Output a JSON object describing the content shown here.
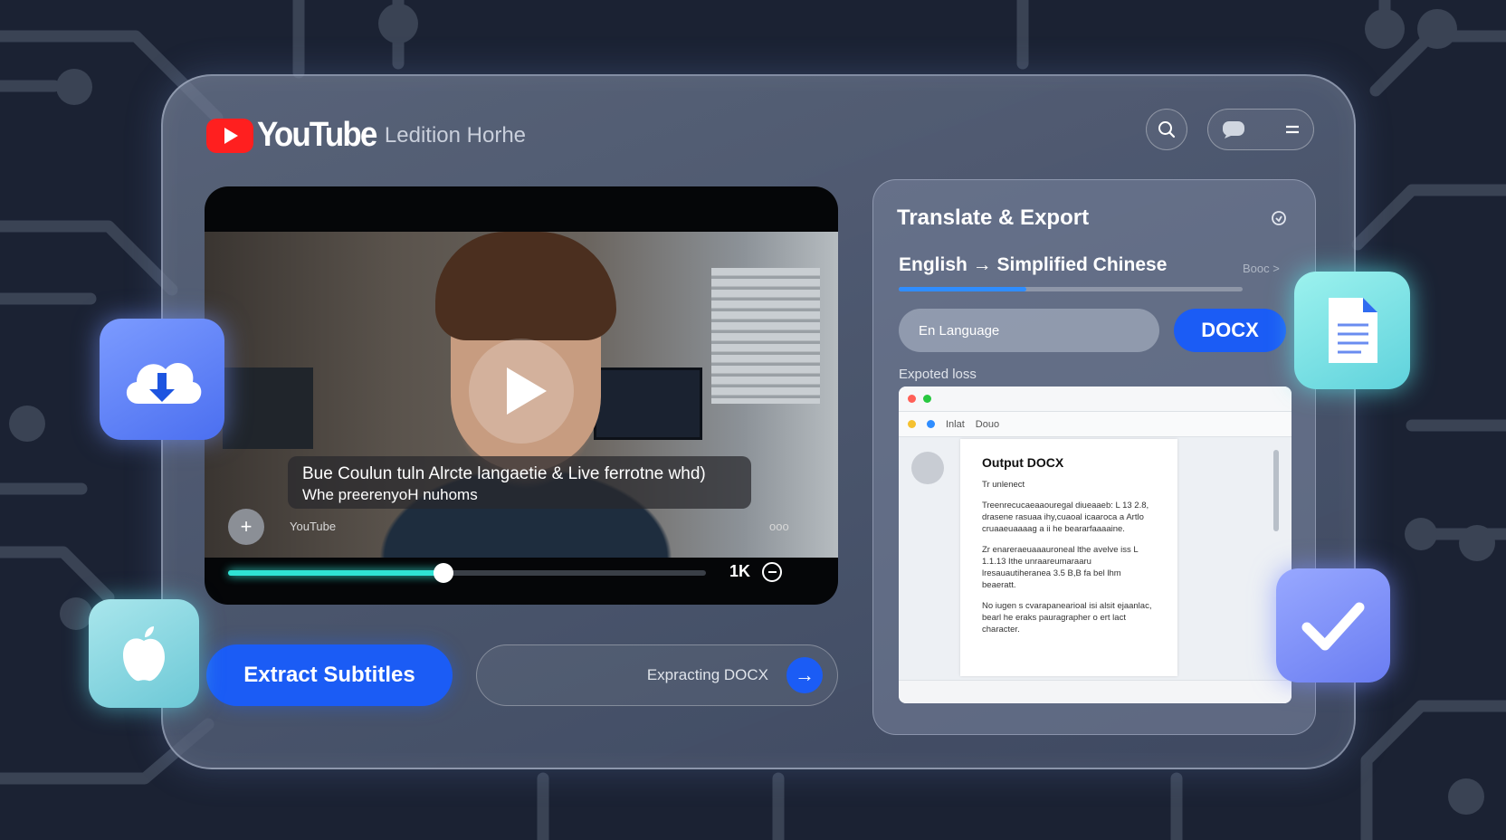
{
  "header": {
    "brand": "YouTube",
    "subtitle": "Ledition Horhe"
  },
  "video": {
    "subtitle_line1": "Bue Coulun tuln Alrcte langaetie & Live ferrotne whd)",
    "subtitle_line2": "Whe preerenyoH nuhoms",
    "channel_badge": "+",
    "channel_name": "YouTube",
    "more_label": "ooo",
    "quality_label": "1K",
    "progress_fraction": 0.45
  },
  "actions": {
    "extract_label": "Extract Subtitles",
    "exporting_label": "Expracting DOCX",
    "go_icon": "→"
  },
  "panel": {
    "title": "Translate & Export",
    "language_pair": "English → Simplified Chinese",
    "language_more": "Booc >",
    "language_progress_fraction": 0.37,
    "language_input_value": "En Language",
    "docx_label": "DOCX",
    "exported_label": "Expoted loss",
    "doc_preview": {
      "toolbar_items": [
        "Inlat",
        "Douo"
      ],
      "heading": "Output DOCX",
      "line1": "Tr unlenect",
      "para1": "Treenrecucaeaaouregal diueaaeb: L 13 2.8, drasene rasuaa ihy,cuaoal icaaroca a Artlo cruaaeuaaaag a ii he beararfaaaaine.",
      "para2": "Zr enareraeuaaauroneal lthe avelve iss L 1.1.13 Ithe unraareumaraaru lresauautiheranea 3.5 B,B fa bel lhm beaeratt.",
      "para3": "No iugen s cvarapanearioal isi alsit ejaanlac, bearl he eraks pauragrapher o ert lact character."
    }
  },
  "floating_icons": [
    "cloud-download-icon",
    "apple-icon",
    "document-icon",
    "checkmark-icon"
  ],
  "colors": {
    "accent_blue": "#1b5cf5",
    "youtube_red": "#ff1f1f",
    "progress_cyan": "#2fe3d5"
  }
}
